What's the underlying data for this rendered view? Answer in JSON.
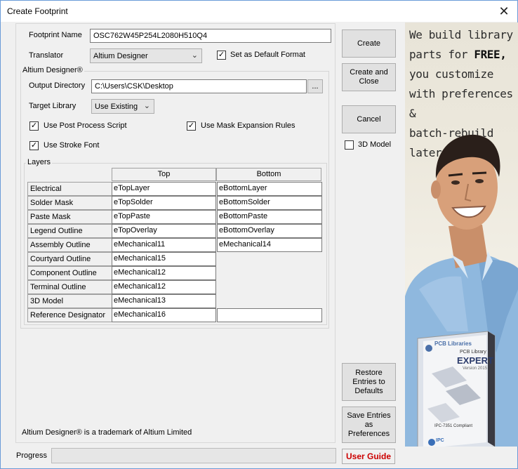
{
  "window": {
    "title": "Create Footprint"
  },
  "form": {
    "footprint_name_label": "Footprint Name",
    "footprint_name_value": "OSC762W45P254L2080H510Q4",
    "translator_label": "Translator",
    "translator_value": "Altium Designer",
    "default_format_label": "Set as Default Format",
    "default_format_checked": true
  },
  "altium_group": {
    "title": "Altium Designer®",
    "output_dir_label": "Output Directory",
    "output_dir_value": "C:\\Users\\CSK\\Desktop",
    "browse_label": "...",
    "target_library_label": "Target Library",
    "target_library_value": "Use Existing",
    "post_process_label": "Use Post Process Script",
    "post_process_checked": true,
    "mask_expansion_label": "Use Mask Expansion Rules",
    "mask_expansion_checked": true,
    "stroke_font_label": "Use Stroke Font",
    "stroke_font_checked": true
  },
  "layers": {
    "title": "Layers",
    "columns": [
      "Top",
      "Bottom"
    ],
    "rows": [
      {
        "name": "Electrical",
        "top": "eTopLayer",
        "bottom": "eBottomLayer"
      },
      {
        "name": "Solder Mask",
        "top": "eTopSolder",
        "bottom": "eBottomSolder"
      },
      {
        "name": "Paste Mask",
        "top": "eTopPaste",
        "bottom": "eBottomPaste"
      },
      {
        "name": "Legend Outline",
        "top": "eTopOverlay",
        "bottom": "eBottomOverlay"
      },
      {
        "name": "Assembly Outline",
        "top": "eMechanical11",
        "bottom": "eMechanical14"
      },
      {
        "name": "Courtyard Outline",
        "top": "eMechanical15",
        "bottom": null
      },
      {
        "name": "Component Outline",
        "top": "eMechanical12",
        "bottom": null
      },
      {
        "name": "Terminal Outline",
        "top": "eMechanical12",
        "bottom": null
      },
      {
        "name": "3D Model",
        "top": "eMechanical13",
        "bottom": null
      },
      {
        "name": "Reference Designator",
        "top": "eMechanical16",
        "bottom": ""
      }
    ]
  },
  "trademark": "Altium Designer® is a trademark of Altium Limited",
  "buttons": {
    "create": "Create",
    "create_close": "Create and Close",
    "cancel": "Cancel",
    "model_3d_label": "3D Model",
    "model_3d_checked": false,
    "restore": "Restore Entries to Defaults",
    "save": "Save Entries as Preferences",
    "user_guide": "User Guide"
  },
  "progress": {
    "label": "Progress",
    "value": 0
  },
  "ad": {
    "line1": "We build library",
    "line2a": "parts for ",
    "line2b": "FREE,",
    "line3": "you customize",
    "line4": "with preferences &",
    "line5": "batch-rebuild later!",
    "box_brand": "PCB Libraries",
    "box_title": "PCB Library",
    "box_edition": "EXPERT",
    "box_version": "Version 2015",
    "box_note": "IPC-7351 Compliant",
    "box_logo": "IPC"
  },
  "colors": {
    "user_guide": "#cc0000",
    "window_border": "#6a9bd8"
  }
}
